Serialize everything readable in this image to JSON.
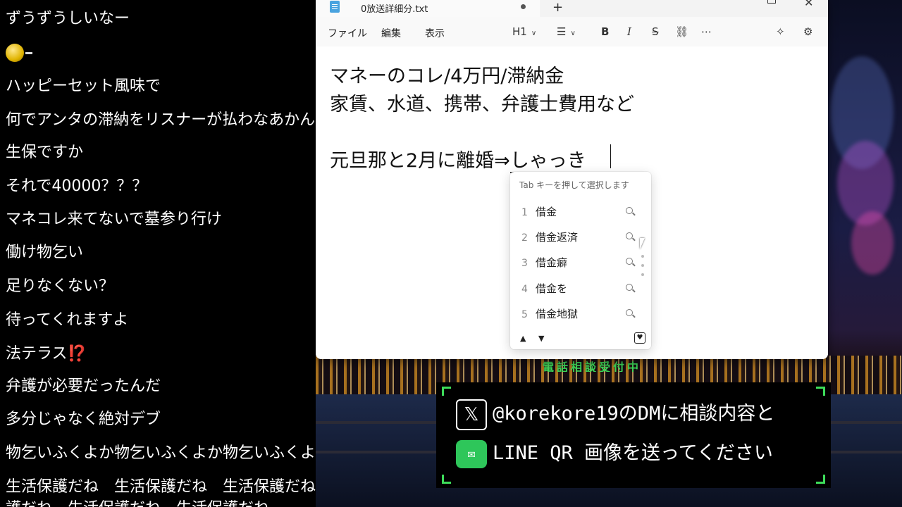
{
  "comments": [
    "ずうずうしいなー",
    "",
    "ハッピーセット風味で",
    "何でアンタの滞納をリスナーが払わなあかんの",
    "生保ですか",
    "それで40000？？？",
    "マネコレ来てないで墓参り行け",
    "働け物乞い",
    "足りなくない？",
    "待ってくれますよ",
    "法テラス",
    "弁護が必要だったんだ",
    "多分じゃなく絶対デブ",
    "物乞いふくよか物乞いふくよか物乞いふくよか",
    "生活保護だね　生活保護だね　生活保護だね",
    "護だね　生活保護だね　生活保護だね"
  ],
  "comment_emoji_icon": "face-emoji-icon",
  "comment_interrobang": "⁉️",
  "notepad": {
    "tab_title": "0放送詳細分.txt",
    "menu": [
      "ファイル",
      "編集",
      "表示"
    ],
    "heading_select": "H1",
    "lines": [
      "マネーのコレ/4万円/滞納金",
      "家賃、水道、携帯、弁護士費用など",
      "元旦那と2月に離婚⇒"
    ],
    "ime_composition": "しゃっき",
    "ime": {
      "hint": "Tab キーを押して選択します",
      "candidates": [
        {
          "num": "1",
          "text": "借金"
        },
        {
          "num": "2",
          "text": "借金返済"
        },
        {
          "num": "3",
          "text": "借金癖"
        },
        {
          "num": "4",
          "text": "借金を"
        },
        {
          "num": "5",
          "text": "借金地獄"
        }
      ]
    }
  },
  "overlay": {
    "banner": "電話相談受付中",
    "line1": "@korekore19のDMに相談内容と",
    "line2": "LINE QR 画像を送ってください",
    "accent_color": "#3ddc5a"
  }
}
